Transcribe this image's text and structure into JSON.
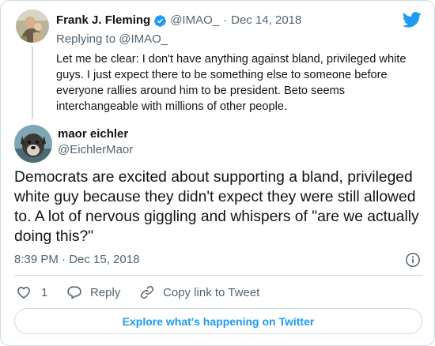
{
  "colors": {
    "brand": "#1d9bf0",
    "text": "#0f1419",
    "muted": "#536471",
    "border": "#cfd9de"
  },
  "quoted_tweet": {
    "author_name": "Frank J. Fleming",
    "verified": true,
    "handle": "@IMAO_",
    "separator": "·",
    "date": "Dec 14, 2018",
    "replying_to": "Replying to @IMAO_",
    "text": "Let me be clear: I don't have anything against bland, privileged white guys. I just expect there to be something else to someone before everyone rallies around him to be president. Beto seems interchangeable with millions of other people.",
    "avatar_icon": "profile-photo"
  },
  "main_tweet": {
    "author_name": "maor eichler",
    "handle": "@EichlerMaor",
    "text": "Democrats are excited about supporting a bland, privileged white guy because they didn't expect they were still allowed to. A lot of nervous giggling and whispers of \"are we actually doing this?\"",
    "timestamp": "8:39 PM · Dec 15, 2018",
    "avatar_icon": "dog-photo"
  },
  "actions": {
    "like_count": "1",
    "reply_label": "Reply",
    "copy_link_label": "Copy link to Tweet"
  },
  "explore_label": "Explore what's happening on Twitter",
  "icons": {
    "brand": "twitter-bird-icon",
    "verified": "verified-badge-icon",
    "info": "info-icon",
    "like": "heart-icon",
    "reply": "reply-bubble-icon",
    "copy": "link-icon"
  }
}
